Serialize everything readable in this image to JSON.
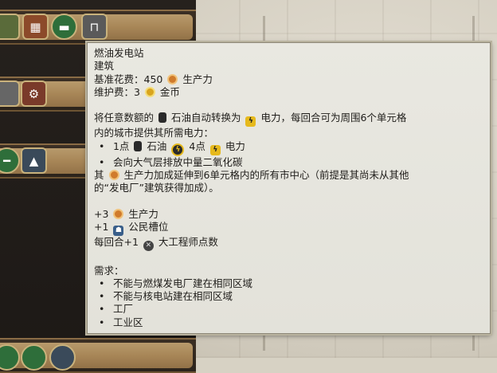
{
  "tooltip": {
    "title": "燃油发电站",
    "type": "建筑",
    "cost_label": "基准花费：450",
    "cost_yield": "生产力",
    "maint_label": "维护费：3",
    "maint_yield": "金币",
    "desc1_a": "将任意数额的",
    "desc1_b": "石油自动转换为",
    "desc1_c": "电力，每回合可为周围6个单元格",
    "desc2": "内的城市提供其所需电力：",
    "b1_a": "1点",
    "b1_b": "石油",
    "b1_c": "4点",
    "b1_d": "电力",
    "b2": "会向大气层排放中量二氧化碳",
    "desc3_a": "其",
    "desc3_b": "生产力加成延伸到6单元格内的所有市中心（前提是其尚未从其他",
    "desc4": "的“发电厂”建筑获得加成）。",
    "y1_a": "+3",
    "y1_b": "生产力",
    "y2_a": "+1",
    "y2_b": "公民槽位",
    "y3_a": "每回合+1",
    "y3_b": "大工程师点数",
    "req_title": "需求：",
    "requirements": [
      "不能与燃煤发电厂建在相同区域",
      "不能与核电站建在相同区域",
      "工厂",
      "工业区"
    ]
  },
  "icons": {
    "production": "production-icon",
    "gold": "gold-icon",
    "oil": "oil-icon",
    "power": "power-icon",
    "citizen": "citizen-slot-icon",
    "engineer": "great-engineer-icon"
  },
  "colors": {
    "tooltip_bg": "#e6e5dd",
    "panel_gold": "#b89a6c"
  }
}
